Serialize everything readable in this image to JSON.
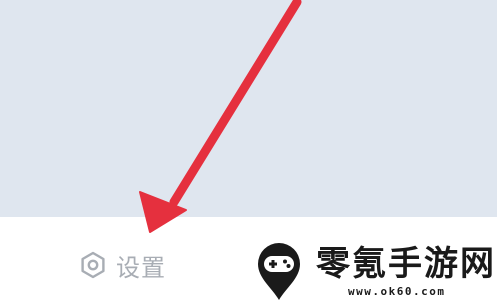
{
  "settings": {
    "label": "设置",
    "icon": "hexagon-gear-icon",
    "color": "#a8adb4"
  },
  "annotation": {
    "arrow_color": "#e5303e"
  },
  "watermark": {
    "title": "零氪手游网",
    "url": "www.ok60.com",
    "logo_icon": "gamepad-pin-icon"
  },
  "colors": {
    "top_background": "#dfe6ef",
    "bottom_background": "#ffffff"
  }
}
